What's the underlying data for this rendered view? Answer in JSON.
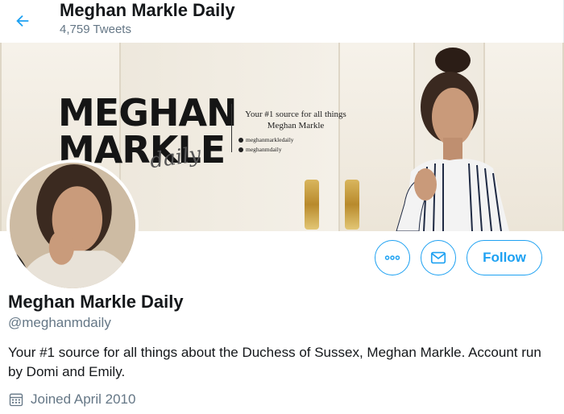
{
  "header": {
    "title": "Meghan Markle Daily",
    "tweet_count": "4,759 Tweets"
  },
  "banner": {
    "brand_line1": "MEGHAN",
    "brand_line2": "MARKLE",
    "brand_script": "daily",
    "tagline": "Your #1 source for all things Meghan Markle",
    "handle_instagram": "meghanmarkledaily",
    "handle_twitter": "meghanmdaily"
  },
  "actions": {
    "more_icon": "more-icon",
    "message_icon": "mail-icon",
    "follow_label": "Follow"
  },
  "profile": {
    "name": "Meghan Markle Daily",
    "handle": "@meghanmdaily",
    "bio": "Your #1 source for all things about the Duchess of Sussex, Meghan Markle. Account run by Domi and Emily.",
    "joined": "Joined April 2010"
  },
  "colors": {
    "accent": "#1da1f2",
    "secondary_text": "#657786",
    "primary_text": "#14171a"
  }
}
